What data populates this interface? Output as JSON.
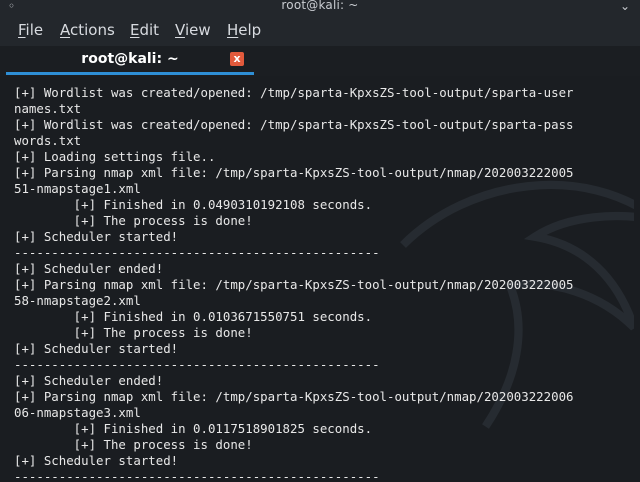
{
  "window": {
    "title": "root@kali: ~"
  },
  "menu": [
    {
      "label": "File",
      "mnemonic": "F",
      "rest": "ile"
    },
    {
      "label": "Actions",
      "mnemonic": "A",
      "rest": "ctions"
    },
    {
      "label": "Edit",
      "mnemonic": "E",
      "rest": "dit"
    },
    {
      "label": "View",
      "mnemonic": "V",
      "rest": "iew"
    },
    {
      "label": "Help",
      "mnemonic": "H",
      "rest": "elp"
    }
  ],
  "tab": {
    "label": "root@kali: ~",
    "close_glyph": "x"
  },
  "terminal": {
    "lines": [
      "[+] Wordlist was created/opened: /tmp/sparta-KpxsZS-tool-output/sparta-user",
      "names.txt",
      "[+] Wordlist was created/opened: /tmp/sparta-KpxsZS-tool-output/sparta-pass",
      "words.txt",
      "[+] Loading settings file..",
      "[+] Parsing nmap xml file: /tmp/sparta-KpxsZS-tool-output/nmap/202003222005",
      "51-nmapstage1.xml",
      "        [+] Finished in 0.0490310192108 seconds.",
      "        [+] The process is done!",
      "[+] Scheduler started!",
      "-------------------------------------------------",
      "[+] Scheduler ended!",
      "[+] Parsing nmap xml file: /tmp/sparta-KpxsZS-tool-output/nmap/202003222005",
      "58-nmapstage2.xml",
      "        [+] Finished in 0.0103671550751 seconds.",
      "        [+] The process is done!",
      "[+] Scheduler started!",
      "-------------------------------------------------",
      "[+] Scheduler ended!",
      "[+] Parsing nmap xml file: /tmp/sparta-KpxsZS-tool-output/nmap/202003222006",
      "06-nmapstage3.xml",
      "        [+] Finished in 0.0117518901825 seconds.",
      "        [+] The process is done!",
      "[+] Scheduler started!",
      "-------------------------------------------------"
    ]
  },
  "colors": {
    "background": "#1a1d21",
    "menubar": "#23272c",
    "tab_accent": "#2e8fd6",
    "close_button": "#e25a3c",
    "text": "#e8e8e8"
  },
  "icons": {
    "titlebar_left": "pin-icon",
    "titlebar_right": "minimize-icon",
    "watermark": "kali-dragon-watermark"
  }
}
